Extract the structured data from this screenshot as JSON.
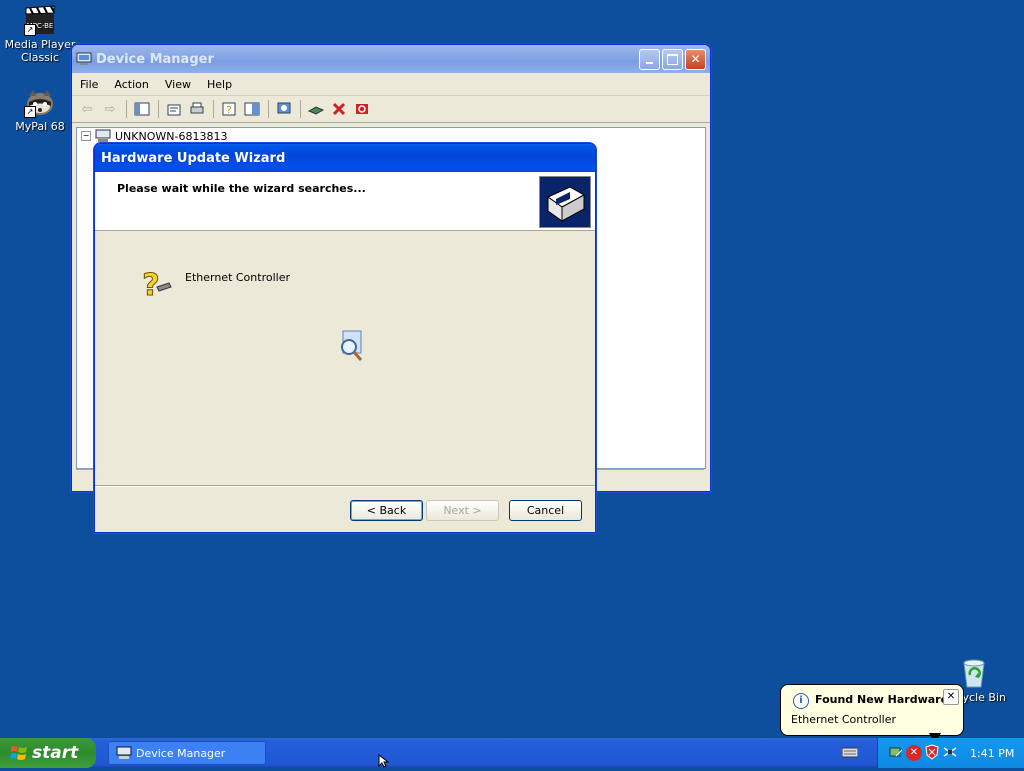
{
  "desktop": {
    "icons": [
      {
        "label": "Media Player Classic",
        "badge": "MPC-BE"
      },
      {
        "label": "MyPal 68"
      },
      {
        "label": "Recycle Bin"
      }
    ]
  },
  "device_manager": {
    "title": "Device Manager",
    "menu": [
      "File",
      "Action",
      "View",
      "Help"
    ],
    "tree_root": "UNKNOWN-6813813"
  },
  "wizard": {
    "title": "Hardware Update Wizard",
    "header_text": "Please wait while the wizard searches...",
    "device_name": "Ethernet Controller",
    "back_label": "< Back",
    "next_label": "Next >",
    "cancel_label": "Cancel"
  },
  "taskbar": {
    "start_label": "start",
    "task_label": "Device Manager",
    "clock": "1:41 PM"
  },
  "balloon": {
    "title": "Found New Hardware",
    "body": "Ethernet Controller"
  },
  "colors": {
    "desktop": "#0d4f9c",
    "title_active": "#0055ea",
    "window_face": "#ece9d8"
  }
}
